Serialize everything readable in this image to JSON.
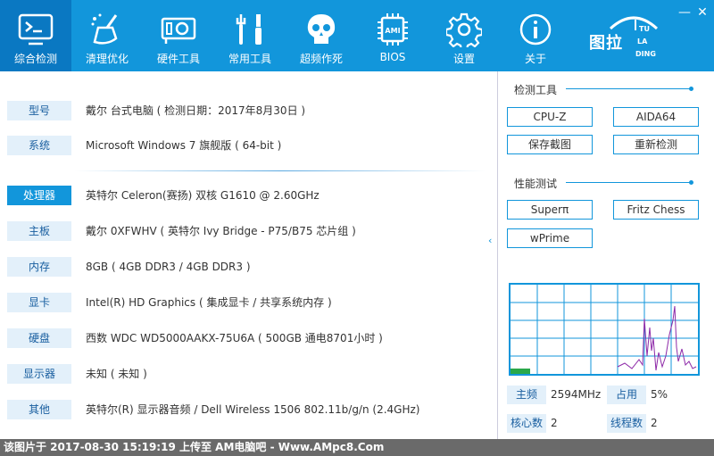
{
  "nav": [
    {
      "label": "综合检测",
      "icon": "monitor-icon",
      "active": true
    },
    {
      "label": "清理优化",
      "icon": "broom-icon"
    },
    {
      "label": "硬件工具",
      "icon": "graphics-card-icon"
    },
    {
      "label": "常用工具",
      "icon": "tools-icon"
    },
    {
      "label": "超频作死",
      "icon": "skull-icon"
    },
    {
      "label": "BIOS",
      "icon": "chip-icon"
    },
    {
      "label": "设置",
      "icon": "gear-icon"
    },
    {
      "label": "关于",
      "icon": "info-icon"
    }
  ],
  "logo": {
    "main": "图拉",
    "t1": "TU",
    "t2": "LA",
    "t3": "DING"
  },
  "window": {
    "minimize": "—",
    "close": "✕"
  },
  "info": {
    "model": {
      "key": "型号",
      "value": "戴尔 台式电脑 ( 检测日期：2017年8月30日 )"
    },
    "os": {
      "key": "系统",
      "value": "Microsoft Windows 7 旗舰版 ( 64-bit )"
    },
    "cpu": {
      "key": "处理器",
      "value": "英特尔  Celeron(赛扬)  双核  G1610 @ 2.60GHz"
    },
    "board": {
      "key": "主板",
      "value": "戴尔 0XFWHV        ( 英特尔 Ivy Bridge - P75/B75 芯片组 )"
    },
    "ram": {
      "key": "内存",
      "value": "8GB ( 4GB DDR3 / 4GB DDR3 )"
    },
    "gpu": {
      "key": "显卡",
      "value": "Intel(R) HD Graphics ( 集成显卡 / 共享系统内存 )"
    },
    "disk": {
      "key": "硬盘",
      "value": "西数 WDC WD5000AAKX-75U6A ( 500GB  通电8701小时 )"
    },
    "monitor": {
      "key": "显示器",
      "value": "未知 ( 未知 )"
    },
    "other": {
      "key": "其他",
      "value": "英特尔(R) 显示器音频 / Dell Wireless 1506 802.11b/g/n (2.4GHz)"
    }
  },
  "collapse_glyph": "‹",
  "tools": {
    "title": "检测工具",
    "cpuz": "CPU-Z",
    "aida": "AIDA64",
    "screenshot": "保存截图",
    "redetect": "重新检测"
  },
  "perf": {
    "title": "性能测试",
    "superpi": "Superπ",
    "fritz": "Fritz Chess",
    "wprime": "wPrime"
  },
  "stats": {
    "freq_k": "主频",
    "freq_v": "2594MHz",
    "usage_k": "占用",
    "usage_v": "5%",
    "cores_k": "核心数",
    "cores_v": "2",
    "threads_k": "线程数",
    "threads_v": "2"
  },
  "footer": {
    "text": "该图片于  2017-08-30  15:19:19  上传至  AM电脑吧  -  Www.AMpc8.Com"
  },
  "colors": {
    "accent": "#1296db",
    "active": "#0a78c2",
    "graph_line": "#8e2aa8",
    "usage_bar": "#2aa84a"
  }
}
